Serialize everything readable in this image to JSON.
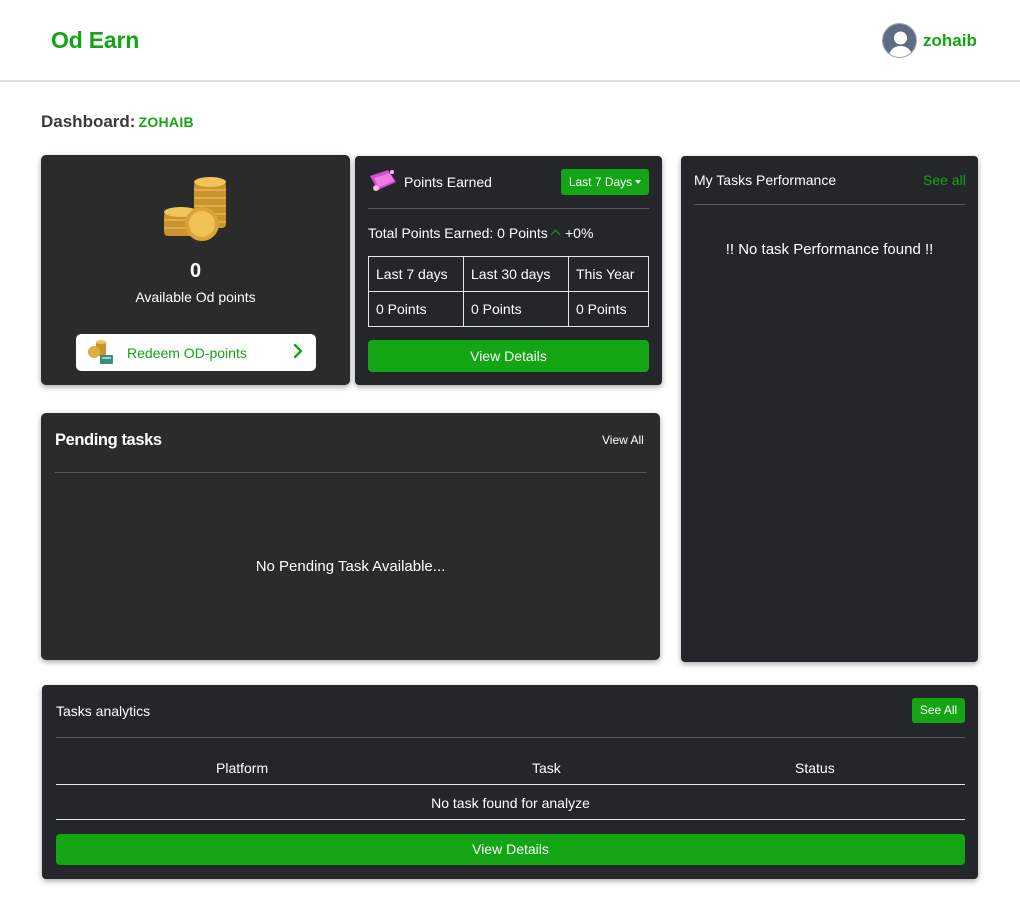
{
  "header": {
    "brand": "Od Earn",
    "username": "zohaib",
    "icons": {
      "avatar": "user-avatar-icon"
    }
  },
  "dashboard": {
    "label": "Dashboard:",
    "username": "ZOHAIB"
  },
  "points_card": {
    "value": "0",
    "label": "Available Od points",
    "redeem_label": "Redeem OD-points",
    "icons": {
      "coins": "gold-coins-icon",
      "redeem": "coins-redeem-icon",
      "chevron": "chevron-right-icon"
    }
  },
  "earned_card": {
    "title": "Points Earned",
    "range_label": "Last 7 Days",
    "total_text": "Total Points Earned: 0 Points",
    "change_text": "+0%",
    "columns": [
      "Last 7 days",
      "Last 30 days",
      "This Year"
    ],
    "values": [
      "0 Points",
      "0 Points",
      "0 Points"
    ],
    "view_details": "View Details",
    "icons": {
      "title": "ticket-icon",
      "change": "arrow-up-icon",
      "range": "caret-down-icon"
    }
  },
  "performance_card": {
    "title": "My Tasks Performance",
    "see_all": "See all",
    "empty": "!! No task Performance found !!"
  },
  "pending_card": {
    "title": "Pending tasks",
    "view_all": "View All",
    "empty": "No Pending Task Available..."
  },
  "analytics_card": {
    "title": "Tasks analytics",
    "see_all": "See All",
    "columns": [
      "Platform",
      "Task",
      "Status"
    ],
    "empty": "No task found for analyze",
    "view_details": "View Details"
  },
  "colors": {
    "accent": "#14a514",
    "card_bg": "#2b2b2b",
    "card_bg_alt": "#24262a",
    "page_bg": "#ffffff"
  }
}
